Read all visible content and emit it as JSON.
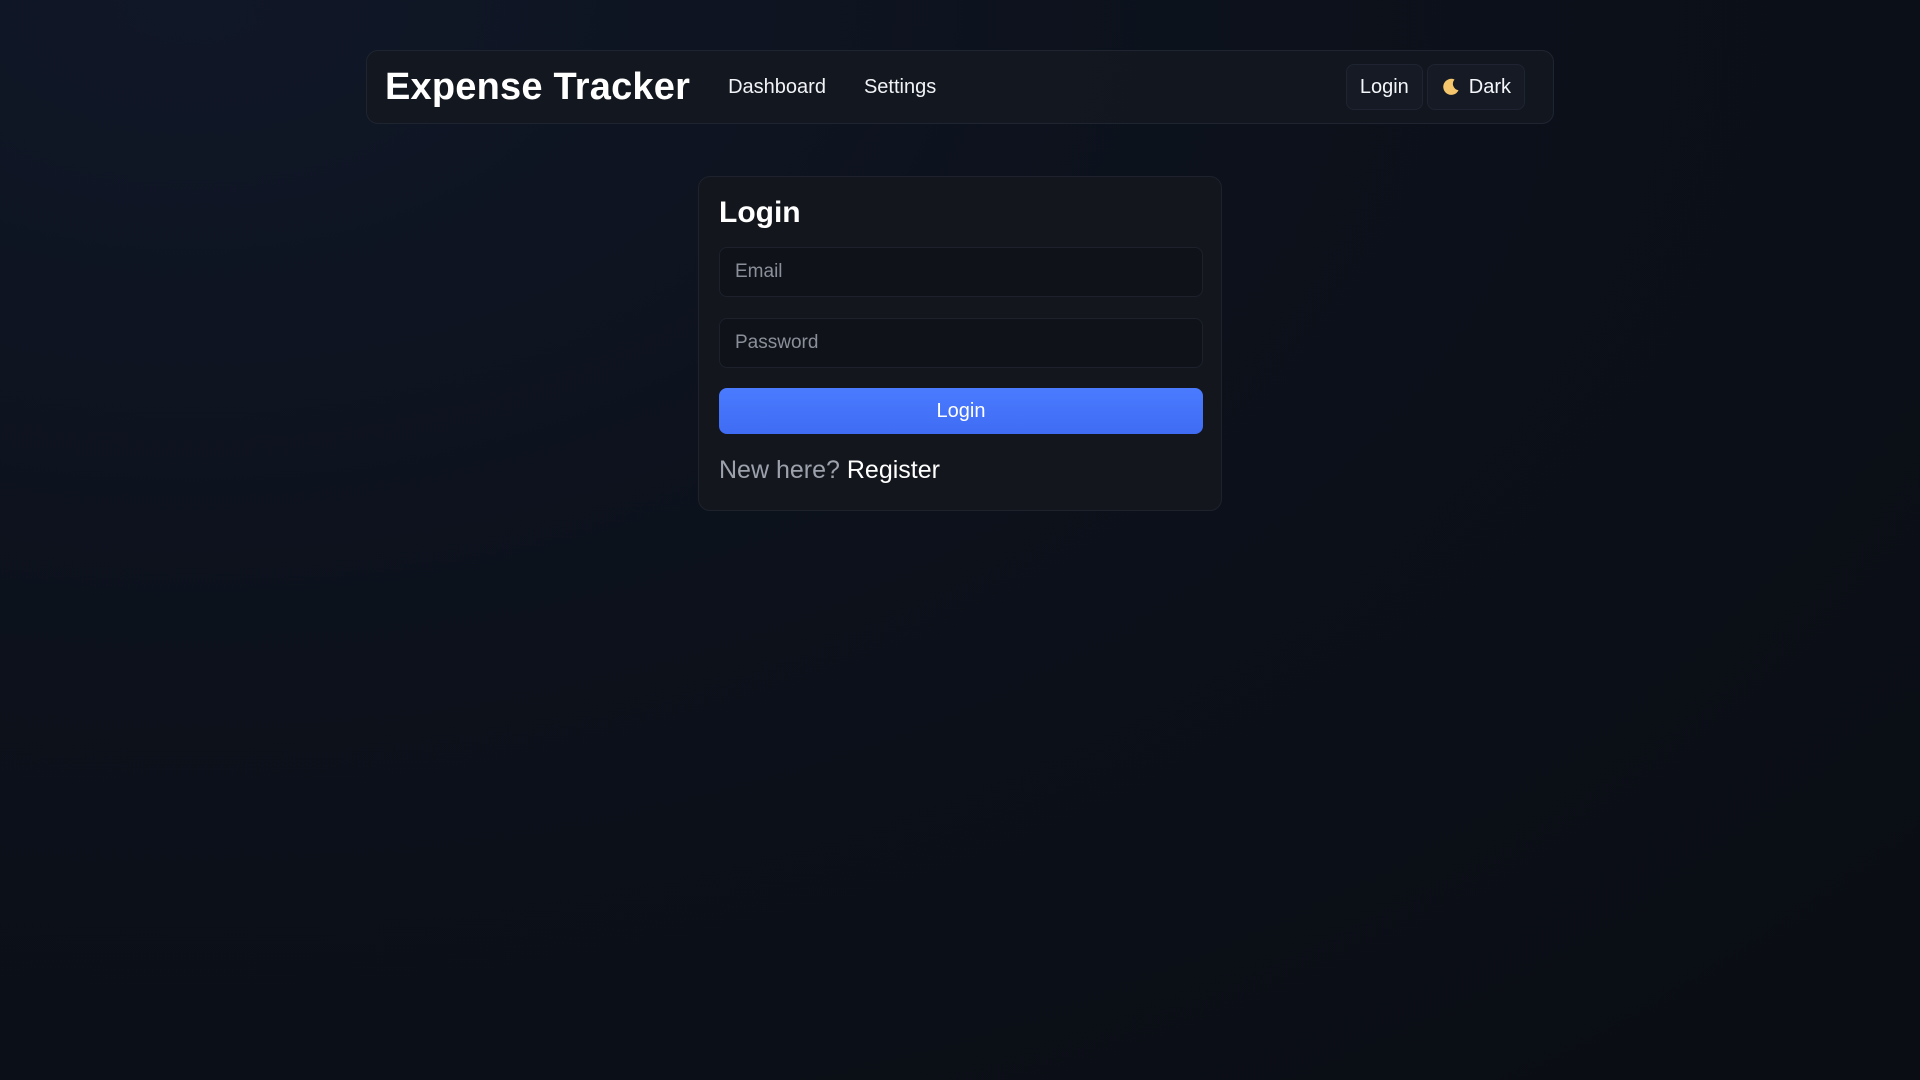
{
  "app": {
    "title": "Expense Tracker"
  },
  "nav": {
    "links": [
      {
        "label": "Dashboard"
      },
      {
        "label": "Settings"
      }
    ],
    "login_label": "Login",
    "theme_label": "Dark",
    "theme_icon": "moon-icon"
  },
  "login_form": {
    "title": "Login",
    "email_placeholder": "Email",
    "email_value": "",
    "password_placeholder": "Password",
    "password_value": "",
    "submit_label": "Login",
    "register_prompt": "New here?",
    "register_link": "Register"
  },
  "colors": {
    "accent": "#4a7bff",
    "background": "#0c111b",
    "card": "#13161d",
    "moon": "#f5c66b"
  }
}
